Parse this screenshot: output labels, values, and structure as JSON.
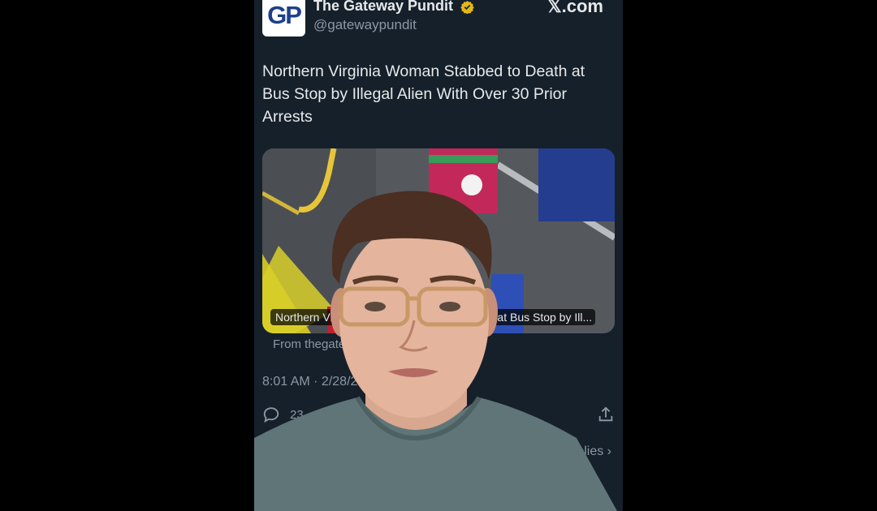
{
  "header": {
    "avatar_text": "GP",
    "display_name": "The Gateway Pundit",
    "handle": "@gatewaypundit",
    "brand": "𝕏.com"
  },
  "tweet": {
    "text": "Northern Virginia Woman Stabbed to Death at Bus Stop by Illegal Alien With Over 30 Prior Arrests",
    "card_caption": "Northern Virginia Woman Stabbed to Death at Bus Stop by Ill...",
    "card_source": "From thegatewaypundit.com",
    "timestamp": "8:01 AM · 2/28/24"
  },
  "actions": {
    "reply_count": "23",
    "read_replies_label": "Read replies"
  },
  "icons": {
    "verified": "verified-badge-icon",
    "reply": "reply-icon",
    "share": "share-icon"
  },
  "colors": {
    "background": "#15202b",
    "text": "#e7e9ea",
    "muted": "#8b98a5",
    "verified": "#e2b719",
    "avatar_blue": "#1d3f8c"
  }
}
